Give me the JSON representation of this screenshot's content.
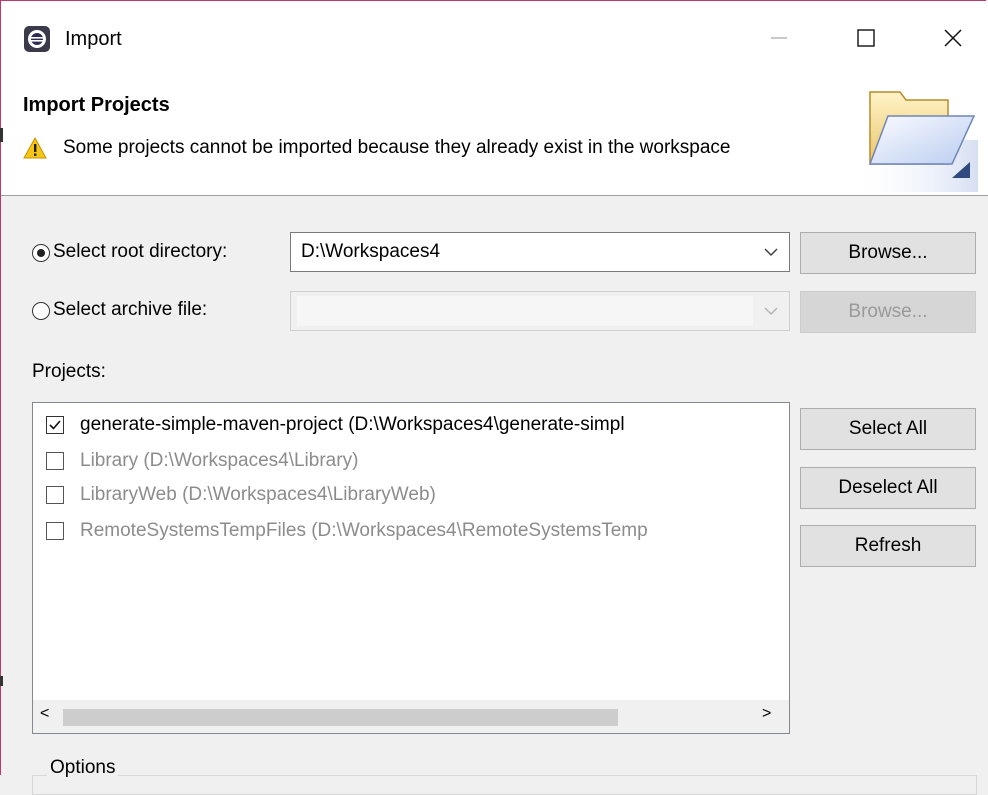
{
  "window": {
    "title": "Import",
    "minimize_glyph": "—",
    "maximize_glyph": "☐",
    "close_glyph": "✕"
  },
  "header": {
    "title": "Import Projects",
    "warning": "Some projects cannot be imported because they already exist in the workspace",
    "icon": "folder-open-icon"
  },
  "source": {
    "root_directory_label": "Select root directory:",
    "root_directory_value": "D:\\Workspaces4",
    "root_directory_selected": true,
    "archive_file_label": "Select archive file:",
    "archive_file_value": "",
    "archive_file_selected": false,
    "browse_label": "Browse...",
    "browse_archive_label": "Browse..."
  },
  "projects": {
    "label": "Projects:",
    "items": [
      {
        "label": "generate-simple-maven-project (D:\\Workspaces4\\generate-simpl",
        "checked": true,
        "enabled": true
      },
      {
        "label": "Library (D:\\Workspaces4\\Library)",
        "checked": false,
        "enabled": false
      },
      {
        "label": "LibraryWeb (D:\\Workspaces4\\LibraryWeb)",
        "checked": false,
        "enabled": false
      },
      {
        "label": "RemoteSystemsTempFiles (D:\\Workspaces4\\RemoteSystemsTemp",
        "checked": false,
        "enabled": false
      }
    ],
    "select_all_label": "Select All",
    "deselect_all_label": "Deselect All",
    "refresh_label": "Refresh",
    "scroll_left_glyph": "<",
    "scroll_right_glyph": ">"
  },
  "options": {
    "label": "Options"
  }
}
